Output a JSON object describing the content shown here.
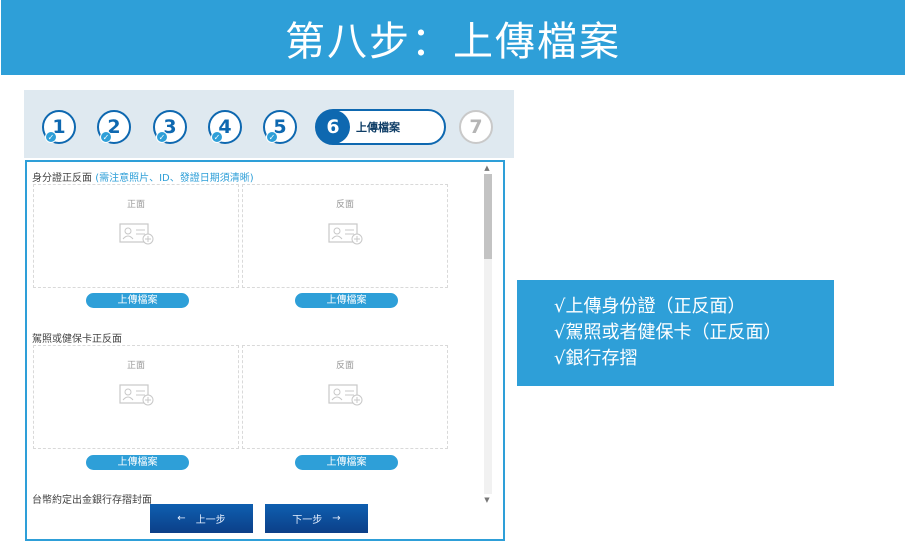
{
  "banner": {
    "title": "第八步：上傳檔案"
  },
  "steps": {
    "done": [
      "1",
      "2",
      "3",
      "4",
      "5"
    ],
    "check_glyph": "✓",
    "active": {
      "number": "6",
      "label": "上傳檔案"
    },
    "future": "7"
  },
  "form": {
    "sections": [
      {
        "title": "身分證正反面",
        "note": "(需注意照片、ID、發證日期須清晰)",
        "front_label": "正面",
        "back_label": "反面",
        "upload_label_front": "上傳檔案",
        "upload_label_back": "上傳檔案"
      },
      {
        "title": "駕照或健保卡正反面",
        "note": "",
        "front_label": "正面",
        "back_label": "反面",
        "upload_label_front": "上傳檔案",
        "upload_label_back": "上傳檔案"
      },
      {
        "title": "台幣約定出金銀行存摺封面"
      }
    ],
    "prev_button": {
      "arrow": "←",
      "label": "上一步"
    },
    "next_button": {
      "label": "下一步",
      "arrow": "→"
    }
  },
  "info": {
    "lines": [
      "√上傳身份證（正反面）",
      "√駕照或者健保卡（正反面）",
      "√銀行存摺"
    ]
  },
  "colors": {
    "accent": "#2e9fd8",
    "primary": "#0e68b0",
    "nav": "#0e4f9c"
  }
}
